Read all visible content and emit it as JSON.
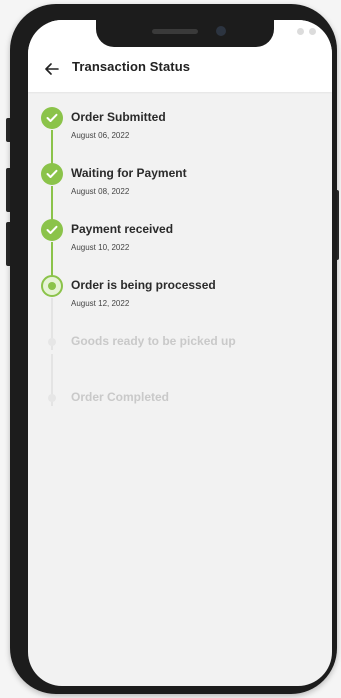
{
  "header": {
    "title": "Transaction Status"
  },
  "colors": {
    "accent": "#8bc34a",
    "pending": "#c9c9c9"
  },
  "steps": [
    {
      "label": "Order Submitted",
      "date": "August 06, 2022",
      "state": "done"
    },
    {
      "label": "Waiting for Payment",
      "date": "August 08, 2022",
      "state": "done"
    },
    {
      "label": "Payment received",
      "date": "August 10, 2022",
      "state": "done"
    },
    {
      "label": "Order is being processed",
      "date": "August 12, 2022",
      "state": "current"
    },
    {
      "label": "Goods ready to be picked up",
      "date": "",
      "state": "pending"
    },
    {
      "label": "Order Completed",
      "date": "",
      "state": "pending"
    }
  ]
}
